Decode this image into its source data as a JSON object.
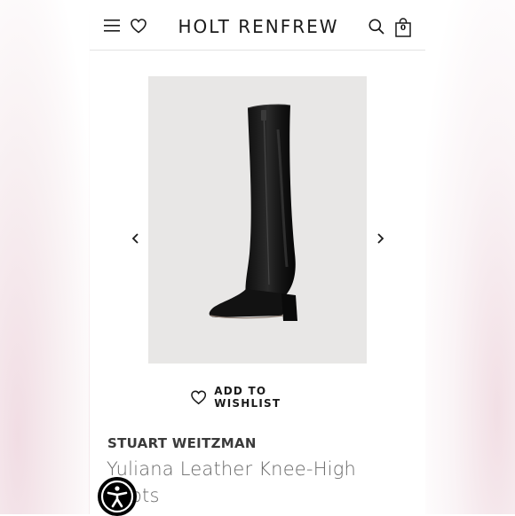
{
  "header": {
    "logo": "HOLT RENFREW",
    "bag_count": "0"
  },
  "icons": {
    "menu": "hamburger-menu-icon",
    "wishlist": "heart-icon",
    "search": "search-icon",
    "bag": "shopping-bag-icon",
    "prev": "chevron-left-icon",
    "next": "chevron-right-icon",
    "accessibility": "accessibility-icon"
  },
  "gallery": {
    "image_alt": "Black leather knee-high boot"
  },
  "wishlist": {
    "label": "ADD TO WISHLIST"
  },
  "product": {
    "brand": "STUART WEITZMAN",
    "name": "Yuliana Leather Knee-High Boots"
  },
  "colors": {
    "text_dark": "#1a1a1a",
    "brand_text": "#3a3a3a",
    "name_text": "#6a6a6a",
    "image_bg": "#e8e7e6",
    "boot": "#141414"
  }
}
